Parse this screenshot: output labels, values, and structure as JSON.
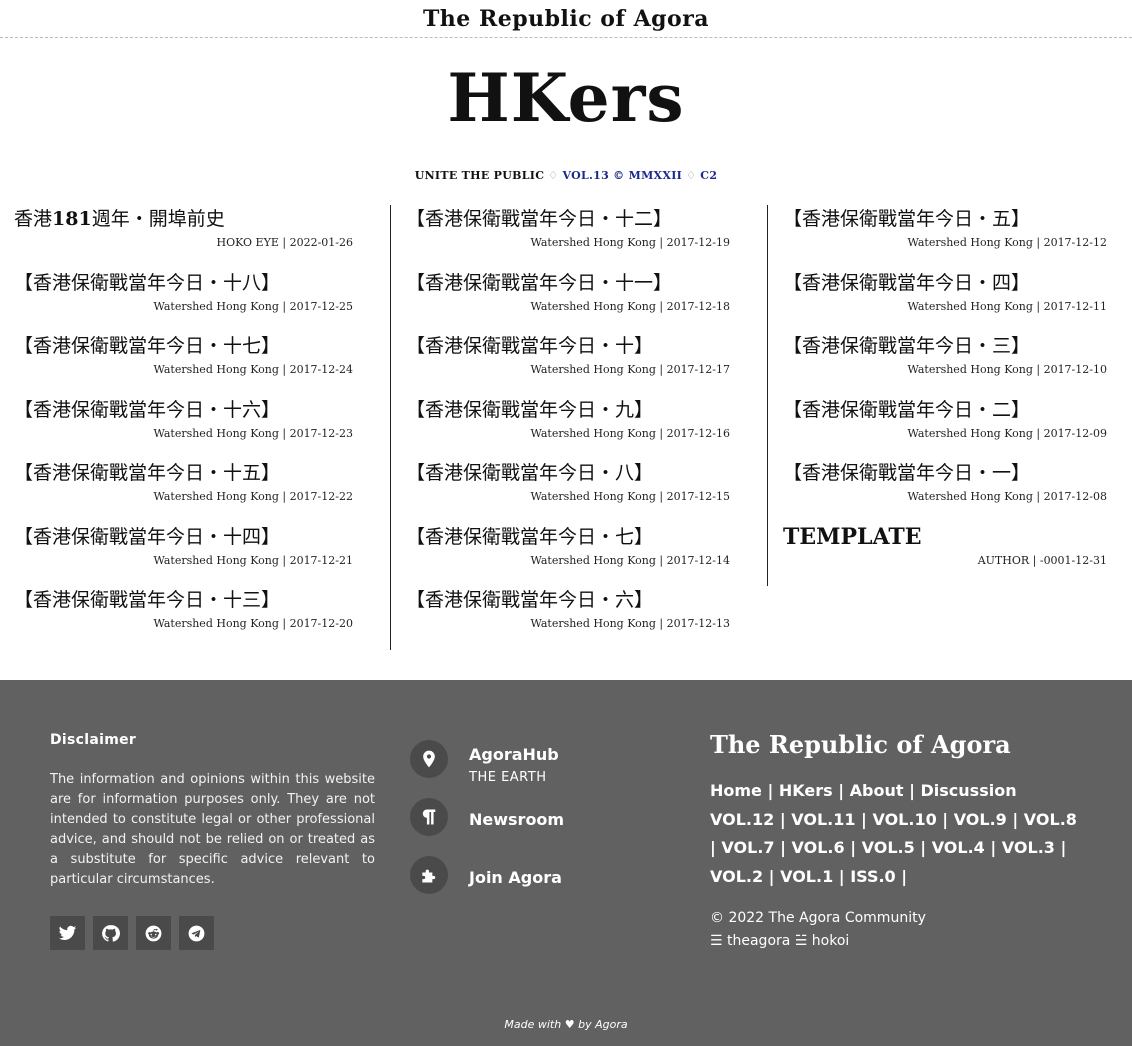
{
  "header": {
    "site_title": "The Republic of Agora",
    "logo": "HKers",
    "subtitle_parts": [
      "UNITE THE PUBLIC",
      "♢",
      "VOL.13 © MMXXII",
      "♢",
      "C2"
    ]
  },
  "articles": {
    "col1": [
      {
        "title_pre": "香港",
        "title_bold": "181",
        "title_post": "週年・開埠前史",
        "meta": "HOKO EYE | 2022-01-26"
      },
      {
        "title": "【香港保衛戰當年今日・十八】",
        "meta": "Watershed Hong Kong | 2017-12-25"
      },
      {
        "title": "【香港保衛戰當年今日・十七】",
        "meta": "Watershed Hong Kong | 2017-12-24"
      },
      {
        "title": "【香港保衛戰當年今日・十六】",
        "meta": "Watershed Hong Kong | 2017-12-23"
      },
      {
        "title": "【香港保衛戰當年今日・十五】",
        "meta": "Watershed Hong Kong | 2017-12-22"
      },
      {
        "title": "【香港保衛戰當年今日・十四】",
        "meta": "Watershed Hong Kong | 2017-12-21"
      },
      {
        "title": "【香港保衛戰當年今日・十三】",
        "meta": "Watershed Hong Kong | 2017-12-20"
      }
    ],
    "col2": [
      {
        "title": "【香港保衛戰當年今日・十二】",
        "meta": "Watershed Hong Kong | 2017-12-19"
      },
      {
        "title": "【香港保衛戰當年今日・十一】",
        "meta": "Watershed Hong Kong | 2017-12-18"
      },
      {
        "title": "【香港保衛戰當年今日・十】",
        "meta": "Watershed Hong Kong | 2017-12-17"
      },
      {
        "title": "【香港保衛戰當年今日・九】",
        "meta": "Watershed Hong Kong | 2017-12-16"
      },
      {
        "title": "【香港保衛戰當年今日・八】",
        "meta": "Watershed Hong Kong | 2017-12-15"
      },
      {
        "title": "【香港保衛戰當年今日・七】",
        "meta": "Watershed Hong Kong | 2017-12-14"
      },
      {
        "title": "【香港保衛戰當年今日・六】",
        "meta": "Watershed Hong Kong | 2017-12-13"
      }
    ],
    "col3": [
      {
        "title": "【香港保衛戰當年今日・五】",
        "meta": "Watershed Hong Kong | 2017-12-12"
      },
      {
        "title": "【香港保衛戰當年今日・四】",
        "meta": "Watershed Hong Kong | 2017-12-11"
      },
      {
        "title": "【香港保衛戰當年今日・三】",
        "meta": "Watershed Hong Kong | 2017-12-10"
      },
      {
        "title": "【香港保衛戰當年今日・二】",
        "meta": "Watershed Hong Kong | 2017-12-09"
      },
      {
        "title": "【香港保衛戰當年今日・一】",
        "meta": "Watershed Hong Kong | 2017-12-08"
      },
      {
        "title": "TEMPLATE",
        "meta": "AUTHOR | -0001-12-31"
      }
    ]
  },
  "footer": {
    "disclaimer_heading": "Disclaimer",
    "disclaimer_text": "The information and opinions within this website are for information purposes only. They are not intended to constitute legal or other professional advice, and should not be relied on or treated as a substitute for specific advice relevant to particular circumstances.",
    "social_icons": [
      "twitter-icon",
      "github-icon",
      "reddit-icon",
      "telegram-icon"
    ],
    "links": [
      {
        "label": "AgoraHub",
        "sub": "THE EARTH",
        "icon": "map-marker-icon"
      },
      {
        "label": "Newsroom",
        "sub": "",
        "icon": "paragraph-icon"
      },
      {
        "label": "Join Agora",
        "sub": "",
        "icon": "puzzle-icon"
      }
    ],
    "site_title": "The Republic of Agora",
    "nav_primary": [
      "Home",
      "HKers",
      "About",
      "Discussion"
    ],
    "nav_volumes": [
      "VOL.12",
      "VOL.11",
      "VOL.10",
      "VOL.9",
      "VOL.8",
      "VOL.7",
      "VOL.6",
      "VOL.5",
      "VOL.4",
      "VOL.3",
      "VOL.2",
      "VOL.1",
      "ISS.0"
    ],
    "copyright": "© 2022 The Agora Community",
    "credits": "☰ theagora ☱ hokoi",
    "made_with": "Made with",
    "made_by": "by Agora"
  }
}
